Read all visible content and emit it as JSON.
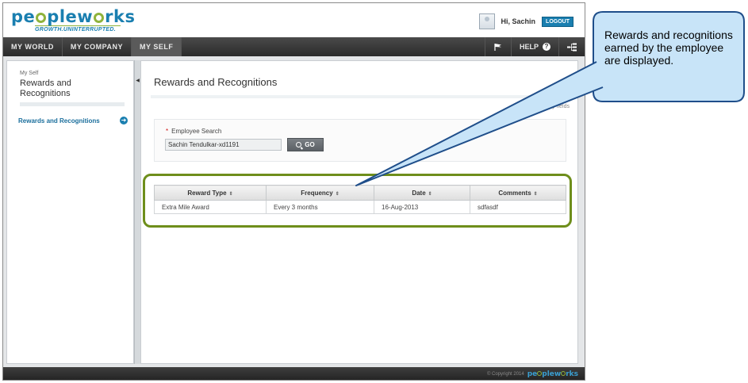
{
  "header": {
    "logo_text": "peopleworks",
    "tagline": "GROWTH.UNINTERRUPTED.",
    "greeting": "Hi, Sachin",
    "logout_label": "LOGOUT"
  },
  "nav": {
    "tabs": [
      {
        "label": "MY WORLD"
      },
      {
        "label": "MY COMPANY"
      },
      {
        "label": "MY SELF"
      }
    ],
    "help_label": "HELP"
  },
  "sidebar": {
    "breadcrumb": "My Self",
    "title": "Rewards and Recognitions",
    "link_label": "Rewards and Recognitions"
  },
  "main": {
    "page_title": "Rewards and Recognitions",
    "mandatory_note": "Mandatory fields",
    "search": {
      "label": "Employee Search",
      "value": "Sachin Tendulkar-xd1191",
      "go_label": "GO"
    },
    "table": {
      "headers": [
        "Reward Type",
        "Frequency",
        "Date",
        "Comments"
      ],
      "rows": [
        [
          "Extra Mile Award",
          "Every 3 months",
          "16-Aug-2013",
          "sdfasdf"
        ]
      ]
    }
  },
  "footer": {
    "copyright": "© Copyright 2014",
    "logo_text": "peopleworks"
  },
  "callout": {
    "text": "Rewards and recognitions earned by the employee are displayed."
  },
  "colors": {
    "brand_blue": "#1a7fb0",
    "brand_green": "#8fb33b",
    "highlight_green": "#6e8e1b",
    "callout_fill": "#c8e4f8",
    "callout_border": "#1f4e8a"
  }
}
